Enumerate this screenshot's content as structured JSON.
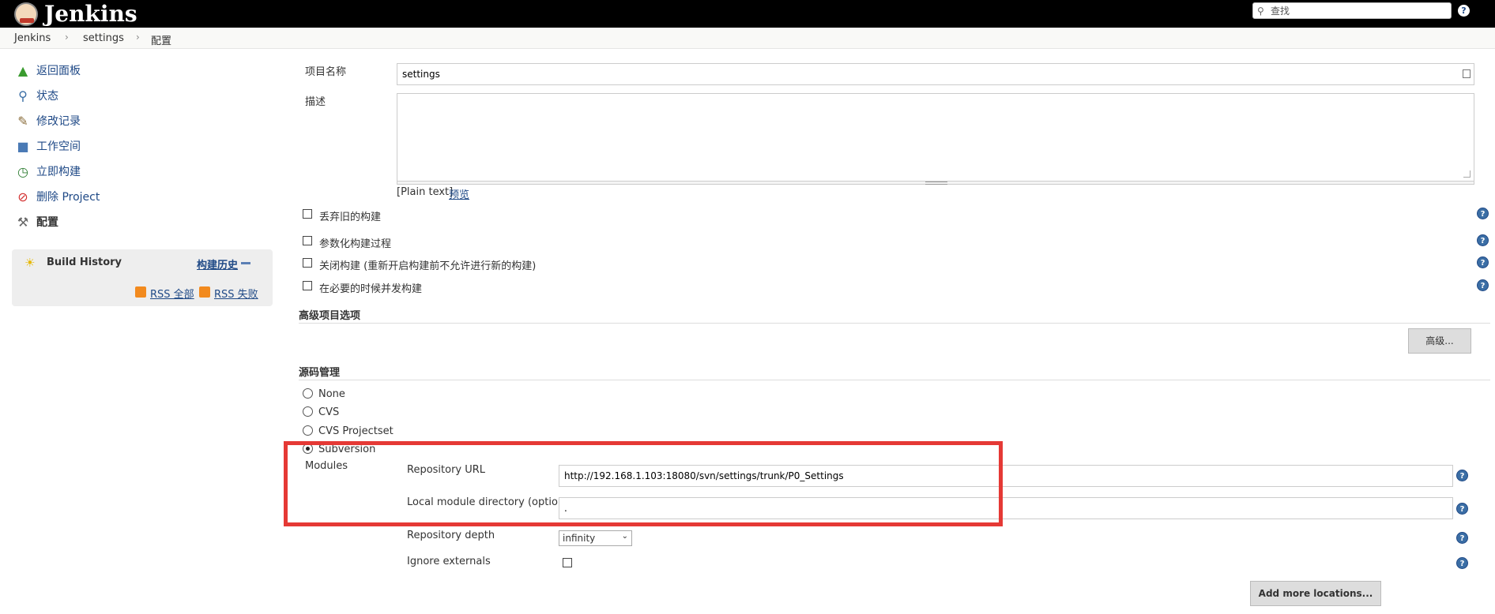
{
  "header": {
    "brand": "Jenkins",
    "search_placeholder": "查找",
    "help": "?"
  },
  "breadcrumb": [
    "Jenkins",
    "settings",
    "配置"
  ],
  "sidebar": {
    "tasks": [
      {
        "label": "返回面板",
        "icon": "up-arrow-icon"
      },
      {
        "label": "状态",
        "icon": "magnifier-icon"
      },
      {
        "label": "修改记录",
        "icon": "notepad-icon"
      },
      {
        "label": "工作空间",
        "icon": "folder-icon"
      },
      {
        "label": "立即构建",
        "icon": "clock-icon"
      },
      {
        "label": "删除 Project",
        "icon": "no-entry-icon"
      },
      {
        "label": "配置",
        "icon": "tools-icon"
      }
    ],
    "build_history": {
      "title": "Build History",
      "trend": "构建历史",
      "rss_all": "RSS 全部",
      "rss_failed": "RSS 失败"
    }
  },
  "form": {
    "project_name_label": "项目名称",
    "project_name_value": "settings",
    "description_label": "描述",
    "plain_text": "[Plain text]",
    "preview": "预览",
    "checkboxes": [
      "丢弃旧的构建",
      "参数化构建过程",
      "关闭构建 (重新开启构建前不允许进行新的构建)",
      "在必要的时候并发构建"
    ],
    "advanced_section": "高级项目选项",
    "advanced_button": "高级...",
    "scm_section": "源码管理",
    "scm_options": [
      "None",
      "CVS",
      "CVS Projectset",
      "Subversion"
    ],
    "scm_selected": "Subversion",
    "modules_label": "Modules",
    "repo_url_label": "Repository URL",
    "repo_url_value": "http://192.168.1.103:18080/svn/settings/trunk/P0_Settings",
    "local_dir_label": "Local module directory (optional)",
    "local_dir_value": ".",
    "depth_label": "Repository depth",
    "depth_value": "infinity",
    "ignore_externals_label": "Ignore externals",
    "add_locations_button": "Add more locations..."
  }
}
